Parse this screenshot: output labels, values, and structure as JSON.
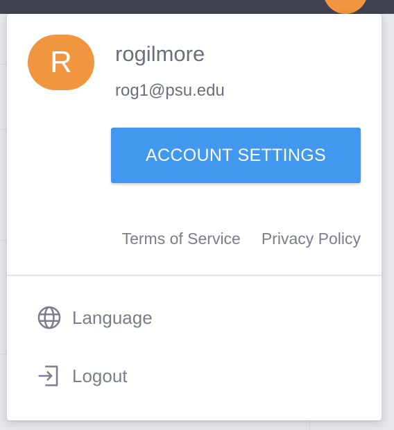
{
  "user": {
    "initial": "R",
    "username": "rogilmore",
    "email": "rog1@psu.edu",
    "avatar_color": "#f0963e"
  },
  "account_button": {
    "label": "ACCOUNT SETTINGS",
    "color": "#4298ef"
  },
  "links": {
    "terms": "Terms of Service",
    "privacy": "Privacy Policy"
  },
  "menu": {
    "items": [
      {
        "label": "Language",
        "icon": "globe-icon"
      },
      {
        "label": "Logout",
        "icon": "logout-icon"
      }
    ]
  }
}
